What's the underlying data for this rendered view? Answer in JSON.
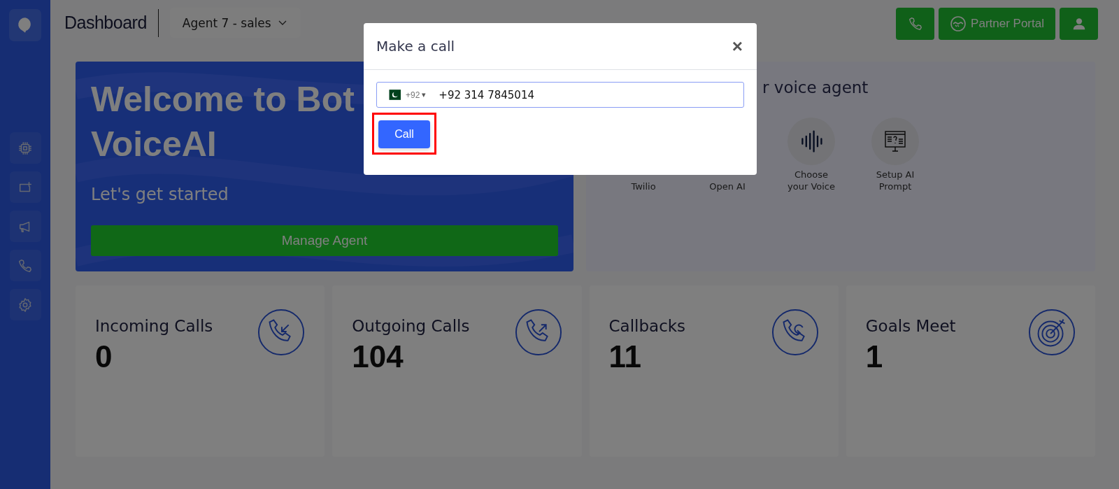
{
  "sidebar": {
    "items": [
      {
        "kind": "chip"
      },
      {
        "kind": "add-screen"
      },
      {
        "kind": "megaphone"
      },
      {
        "kind": "phone"
      },
      {
        "kind": "settings"
      }
    ]
  },
  "header": {
    "title": "Dashboard",
    "agent_select": "Agent 7 - sales",
    "buttons": [
      {
        "kind": "phone"
      },
      {
        "kind": "partner",
        "label": "Partner Portal"
      },
      {
        "kind": "user"
      }
    ]
  },
  "welcome": {
    "title_lines": [
      "Welcome to Bot",
      "VoiceAI"
    ],
    "subtitle": "Let's get started",
    "button": "Manage Agent"
  },
  "setup": {
    "title": "r voice agent",
    "steps": [
      {
        "kind": "hidden",
        "label": "Twilio"
      },
      {
        "kind": "hidden",
        "label": "Open AI"
      },
      {
        "kind": "voice",
        "label": "Choose your Voice"
      },
      {
        "kind": "prompt",
        "label": "Setup AI Prompt"
      }
    ]
  },
  "stats": [
    {
      "kind": "incoming",
      "label": "Incoming Calls",
      "value": "0"
    },
    {
      "kind": "outgoing",
      "label": "Outgoing Calls",
      "value": "104"
    },
    {
      "kind": "callback",
      "label": "Callbacks",
      "value": "11"
    },
    {
      "kind": "goal",
      "label": "Goals Meet",
      "value": "1"
    }
  ],
  "modal": {
    "title": "Make a call",
    "close": "×",
    "country_code": "+92",
    "caret": "▾",
    "phone": "+92 314 7845014",
    "call_button": "Call",
    "call_highlighted": true
  }
}
